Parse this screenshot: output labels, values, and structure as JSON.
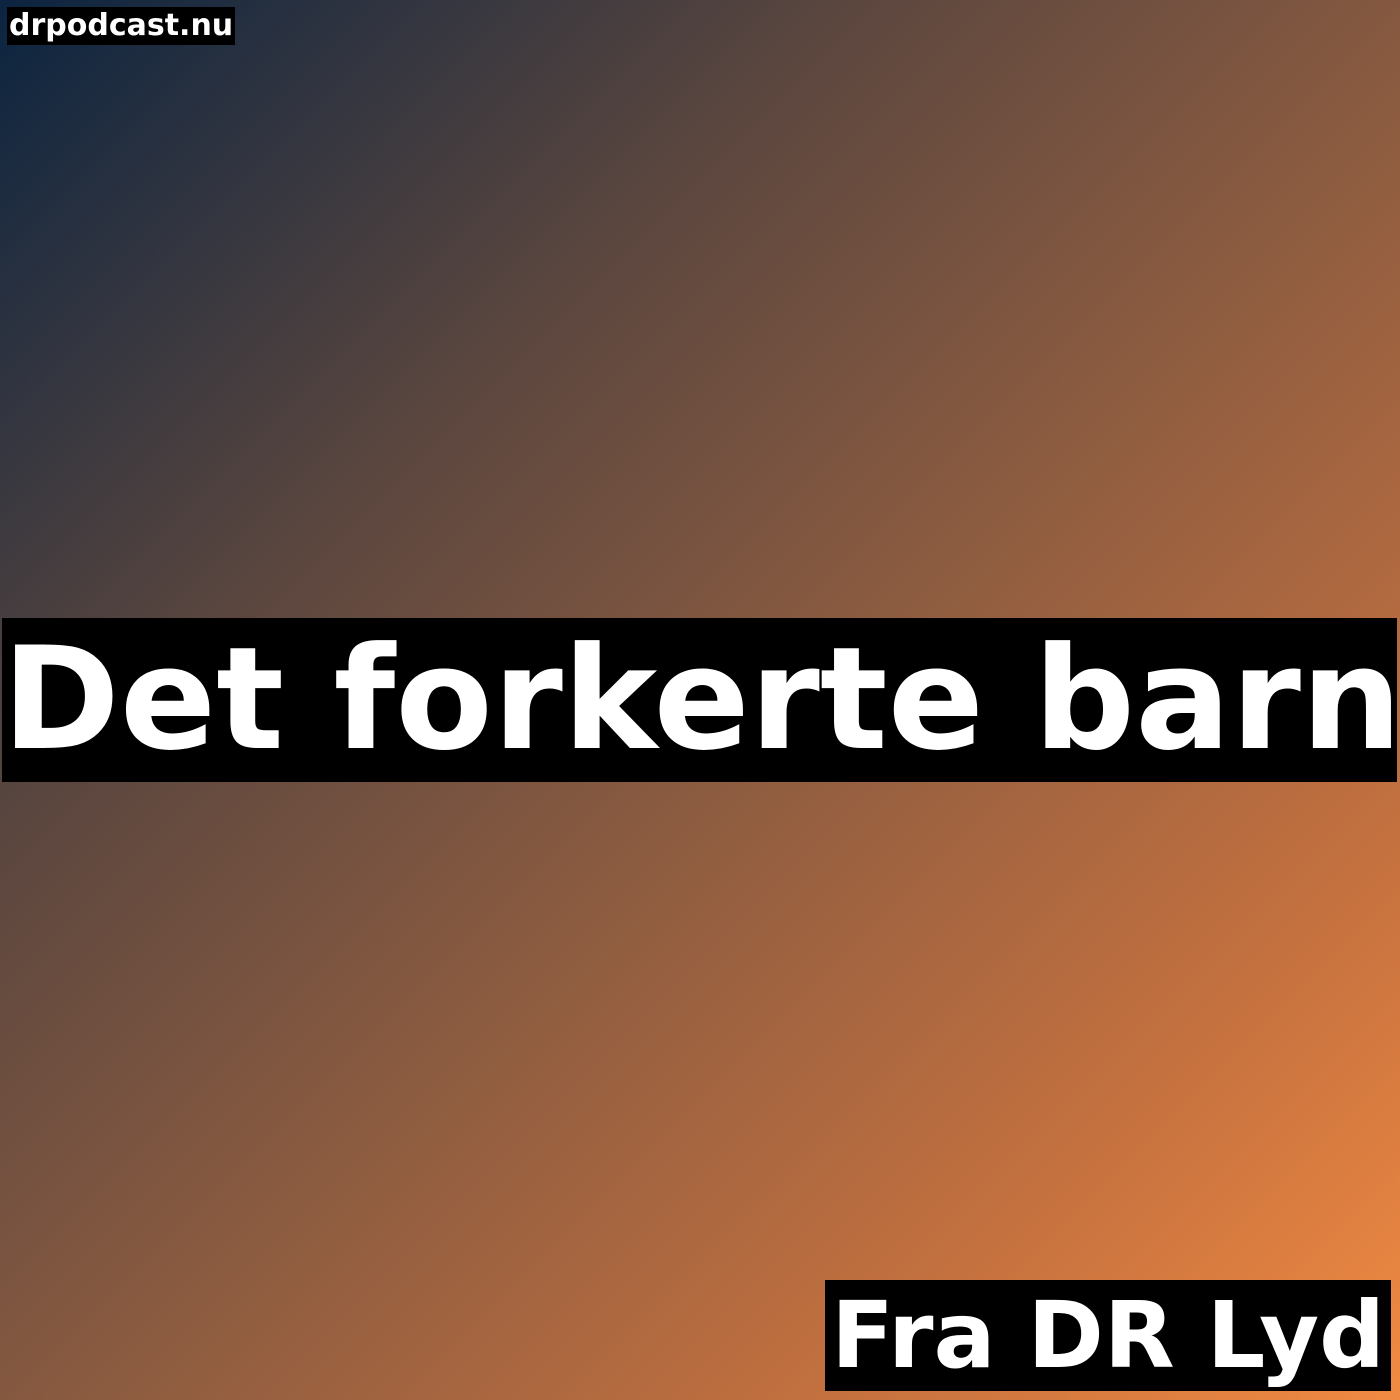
{
  "site": {
    "label": "drpodcast.nu"
  },
  "podcast": {
    "title": "Det forkerte barn",
    "source": "Fra DR Lyd"
  },
  "colors": {
    "gradient_start": "#0b2440",
    "gradient_end": "#f18a42",
    "label_background": "#000000",
    "label_text": "#ffffff"
  }
}
